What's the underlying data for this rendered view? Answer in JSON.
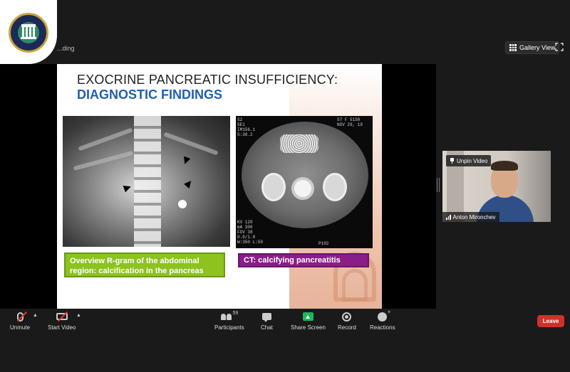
{
  "meeting": {
    "recording_label": "...ding",
    "gallery_view_label": "Gallery View"
  },
  "slide": {
    "title_line1": "EXOCRINE PANCREATIC INSUFFICIENCY:",
    "title_line2": "DIAGNOSTIC FINDINGS",
    "caption_left": "Overview R-gram of the abdominal region: calcification in the pancreas",
    "caption_right": "CT: calcifying pancreatitis",
    "ct_text_top_left": "S2\nSE1\nIM156.1\nS:38.2",
    "ct_text_top_right": "S7 F 5150\nNOV 29, 19\n ",
    "ct_text_bottom_left": "KV 120\nmA 300\nFOV 38\n0.0/1.0\nW:350 L:50",
    "ct_text_bottom_right": "P102"
  },
  "participant_video": {
    "name": "Anton Mironchev",
    "unpin_label": "Unpin Video"
  },
  "toolbar": {
    "unmute_label": "Unmute",
    "start_video_label": "Start Video",
    "participants_label": "Participants",
    "participants_count": "59",
    "chat_label": "Chat",
    "share_screen_label": "Share Screen",
    "record_label": "Record",
    "reactions_label": "Reactions",
    "leave_label": "Leave"
  },
  "colors": {
    "leave_red": "#d0302a",
    "share_green": "#1fb55a",
    "caption_green": "#8dc21f",
    "caption_purple": "#8a1e88",
    "title_blue": "#1f5fb0"
  }
}
